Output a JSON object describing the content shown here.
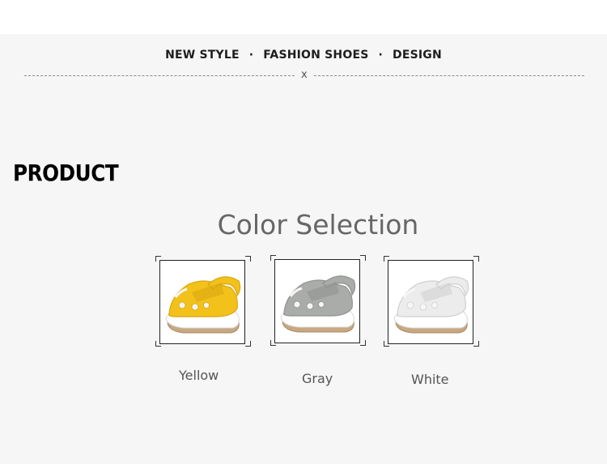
{
  "header": {
    "tagline_1": "NEW STYLE",
    "tagline_sep": "·",
    "tagline_2": "FASHION SHOES",
    "tagline_3": "DESIGN",
    "divider_mark": "x"
  },
  "section": {
    "heading": "PRODUCT",
    "subheading": "Color Selection"
  },
  "swatches": [
    {
      "label": "Yellow",
      "color": "#f2c21b",
      "shade": "#d9a50f",
      "icon": "yellow-sandal-image"
    },
    {
      "label": "Gray",
      "color": "#a9aca8",
      "shade": "#8f928e",
      "icon": "gray-sandal-image"
    },
    {
      "label": "White",
      "color": "#ececec",
      "shade": "#cfcfcf",
      "icon": "white-sandal-image"
    }
  ]
}
